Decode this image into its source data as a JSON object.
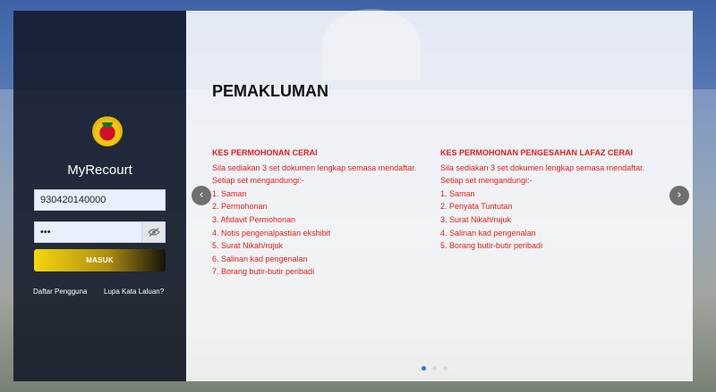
{
  "login": {
    "app_title": "MyRecourt",
    "username_value": "930420140000",
    "password_value": "•••",
    "submit_label": "MASUK",
    "register_link": "Daftar Pengguna",
    "forgot_link": "Lupa Kata Laluan?"
  },
  "notice": {
    "title": "PEMAKLUMAN",
    "columns": [
      {
        "heading": "KES PERMOHONAN CERAI",
        "intro": "Sila sediakan 3 set dokumen lengkap semasa mendaftar.",
        "subintro": "Setiap set mengandungi:-",
        "items": [
          "1. Saman",
          "2. Permohonan",
          "3. Afidavit Permohonan",
          "4. Notis pengenalpastian ekshibit",
          "5. Surat Nikah/rujuk",
          "6. Salinan kad pengenalan",
          "7. Borang butir-butir peribadi"
        ]
      },
      {
        "heading": "KES PERMOHONAN PENGESAHAN LAFAZ CERAI",
        "intro": "Sila sediakan 3 set dokumen lengkap semasa mendaftar.",
        "subintro": "Setiap set mengandungi:-",
        "items": [
          "1. Saman",
          "2. Penyata Tuntutan",
          "3. Surat Nikah/rujuk",
          "4. Salinan kad pengenalan",
          "5. Borang butir-butir peribadi"
        ]
      }
    ]
  },
  "carousel": {
    "prev": "‹",
    "next": "›",
    "active_index": 0,
    "slide_count": 3
  },
  "colors": {
    "notice_text": "#e11d1d",
    "accent_blue": "#2c7be5",
    "button_gold": "#f4d70c"
  }
}
